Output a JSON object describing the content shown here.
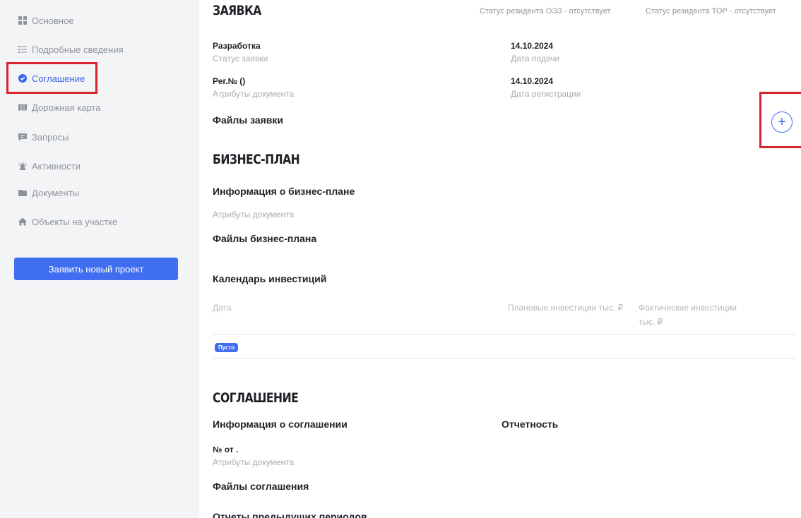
{
  "sidebar": {
    "items": [
      {
        "label": "Основное",
        "icon": "grid-icon"
      },
      {
        "label": "Подробные сведения",
        "icon": "list-icon"
      },
      {
        "label": "Соглашение",
        "icon": "check-circle-icon",
        "active": true
      },
      {
        "label": "Дорожная карта",
        "icon": "map-icon"
      },
      {
        "label": "Запросы",
        "icon": "chat-icon"
      },
      {
        "label": "Активности",
        "icon": "alarm-icon"
      },
      {
        "label": "Документы",
        "icon": "folder-icon"
      },
      {
        "label": "Объекты на участке",
        "icon": "home-icon"
      }
    ],
    "new_project_button": "Заявить новый проект"
  },
  "application": {
    "title": "ЗАЯВКА",
    "status_oez": "Статус резидента ОЭЗ - отсутствует",
    "status_tor": "Статус резидента ТОР - отсутствует",
    "status_value": "Разработка",
    "status_label": "Статус заявки",
    "submit_date": "14.10.2024",
    "submit_label": "Дата подачи",
    "reg_value": "Рег.№ ()",
    "reg_label": "Атрибуты документа",
    "reg_date": "14.10.2024",
    "reg_date_label": "Дата регистрации",
    "files_title": "Файлы заявки",
    "add_button": "+"
  },
  "business_plan": {
    "title": "БИЗНЕС-ПЛАН",
    "info_title": "Информация о бизнес-плане",
    "attrs_label": "Атрибуты документа",
    "files_title": "Файлы бизнес-плана",
    "calendar_title": "Календарь инвестиций",
    "columns": [
      "Дата",
      "Плановые инвестиции тыс. ₽",
      "Фактические инвестиции тыс. ₽"
    ],
    "empty_badge": "Пусто"
  },
  "agreement": {
    "title": "СОГЛАШЕНИЕ",
    "info_title": "Информация о соглашении",
    "reporting_title": "Отчетность",
    "number_value": "№ от .",
    "attrs_label": "Атрибуты документа",
    "files_title": "Файлы соглашения",
    "prev_reports_title": "Отчеты предыдущих периодов"
  },
  "colors": {
    "accent": "#3f6ef0",
    "highlight": "#d9232d",
    "sidebar_bg": "#f3f4f6"
  }
}
